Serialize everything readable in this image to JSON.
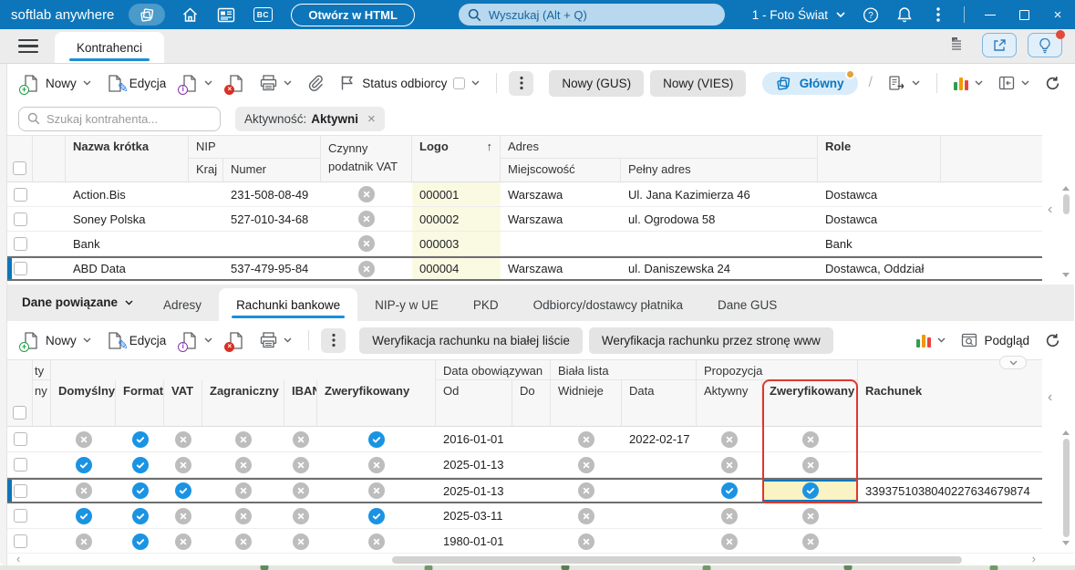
{
  "title_bar": {
    "app_name": "softlab anywhere",
    "bc_label": "BC",
    "open_html_label": "Otwórz w HTML",
    "search_placeholder": "Wyszukaj (Alt + Q)",
    "company": "1 - Foto Świat"
  },
  "tab_bar": {
    "active_tab": "Kontrahenci"
  },
  "toolbar_upper": {
    "new_label": "Nowy",
    "edit_label": "Edycja",
    "status_label": "Status odbiorcy",
    "new_gus_label": "Nowy (GUS)",
    "new_vies_label": "Nowy (VIES)",
    "main_view_label": "Główny",
    "slash": "/"
  },
  "filters": {
    "search_placeholder": "Szukaj kontrahenta...",
    "activity_label": "Aktywność:",
    "activity_value": "Aktywni"
  },
  "upper_grid": {
    "headers": {
      "nazwa": "Nazwa krótka",
      "nip": "NIP",
      "kraj": "Kraj",
      "numer": "Numer",
      "czynny": "Czynny podatnik VAT",
      "logo": "Logo",
      "adres": "Adres",
      "miejscowosc": "Miejscowość",
      "pelny_adres": "Pełny adres",
      "role": "Role"
    },
    "sort_icon": "↑",
    "rows": [
      {
        "name": "Action.Bis",
        "nip": "231-508-08-49",
        "vat_active": "cross",
        "logo": "000001",
        "city": "Warszawa",
        "address": "Ul. Jana Kazimierza 46",
        "role": "Dostawca",
        "selected": false
      },
      {
        "name": "Soney Polska",
        "nip": "527-010-34-68",
        "vat_active": "cross",
        "logo": "000002",
        "city": "Warszawa",
        "address": "ul. Ogrodowa 58",
        "role": "Dostawca",
        "selected": false
      },
      {
        "name": "Bank",
        "nip": "",
        "vat_active": "cross",
        "logo": "000003",
        "city": "",
        "address": "",
        "role": "Bank",
        "selected": false
      },
      {
        "name": "ABD Data",
        "nip": "537-479-95-84",
        "vat_active": "cross",
        "logo": "000004",
        "city": "Warszawa",
        "address": "ul. Daniszewska 24",
        "role": "Dostawca, Oddział",
        "selected": true
      }
    ]
  },
  "detail_tabs": {
    "menu_label": "Dane powiązane",
    "tabs": [
      "Adresy",
      "Rachunki bankowe",
      "NIP-y w UE",
      "PKD",
      "Odbiorcy/dostawcy płatnika",
      "Dane GUS"
    ],
    "active_tab": "Rachunki bankowe"
  },
  "toolbar_lower": {
    "new_label": "Nowy",
    "edit_label": "Edycja",
    "verify_whitelist_label": "Weryfikacja rachunku na białej liście",
    "verify_www_label": "Weryfikacja rachunku przez stronę www",
    "preview_label": "Podgląd"
  },
  "lower_grid": {
    "group_headers": {
      "truncated": "ty",
      "validity": "Data obowiązywan",
      "whitelist": "Biała lista",
      "proposal": "Propozycja"
    },
    "headers": {
      "truncated": "ny",
      "domyslny": "Domyślny",
      "format": "Format",
      "vat": "VAT",
      "zagraniczny": "Zagraniczny",
      "iban": "IBAN",
      "zweryfikowany": "Zweryfikowany",
      "od": "Od",
      "do": "Do",
      "widnieje": "Widnieje",
      "data": "Data",
      "aktywny": "Aktywny",
      "prop_zweryfikowany": "Zweryfikowany",
      "rachunek": "Rachunek"
    },
    "rows": [
      {
        "domyslny": "cross",
        "format": "check",
        "vat": "cross",
        "zagraniczny": "cross",
        "iban": "cross",
        "zweryfikowany": "check",
        "od": "2016-01-01",
        "do": "",
        "widnieje": "cross",
        "data": "2022-02-17",
        "aktywny": "cross",
        "prop_zweryfikowany": "cross",
        "rachunek": "",
        "selected": false
      },
      {
        "domyslny": "check",
        "format": "check",
        "vat": "cross",
        "zagraniczny": "cross",
        "iban": "cross",
        "zweryfikowany": "cross",
        "od": "2025-01-13",
        "do": "",
        "widnieje": "cross",
        "data": "",
        "aktywny": "cross",
        "prop_zweryfikowany": "cross",
        "rachunek": "",
        "selected": false
      },
      {
        "domyslny": "cross",
        "format": "check",
        "vat": "check",
        "zagraniczny": "cross",
        "iban": "cross",
        "zweryfikowany": "cross",
        "od": "2025-01-13",
        "do": "",
        "widnieje": "cross",
        "data": "",
        "aktywny": "check",
        "prop_zweryfikowany": "check",
        "rachunek": "3393751038040227634679874",
        "selected": true
      },
      {
        "domyslny": "check",
        "format": "check",
        "vat": "cross",
        "zagraniczny": "cross",
        "iban": "cross",
        "zweryfikowany": "check",
        "od": "2025-03-11",
        "do": "",
        "widnieje": "cross",
        "data": "",
        "aktywny": "cross",
        "prop_zweryfikowany": "cross",
        "rachunek": "",
        "selected": false
      },
      {
        "domyslny": "cross",
        "format": "check",
        "vat": "cross",
        "zagraniczny": "cross",
        "iban": "cross",
        "zweryfikowany": "cross",
        "od": "1980-01-01",
        "do": "",
        "widnieje": "cross",
        "data": "",
        "aktywny": "cross",
        "prop_zweryfikowany": "cross",
        "rachunek": "",
        "selected": false
      }
    ]
  },
  "icons": {
    "new": "document-plus",
    "edit": "document-pencil",
    "info": "document-info",
    "delete": "document-delete",
    "print": "printer",
    "attachment": "paperclip",
    "status_flag": "flag",
    "chart": "bar-chart",
    "refresh": "refresh",
    "export": "document-export",
    "dock": "dock-left-panel",
    "preview": "preview-window",
    "search": "magnifier",
    "more": "kebab-menu",
    "check": "check-circle",
    "cross": "cross-circle"
  },
  "colors": {
    "titlebar": "#0d76ba",
    "accent_blue": "#1b8fd6",
    "check_circle": "#1b93e3",
    "cross_circle": "#bdbdbd",
    "highlight_red": "#df372c",
    "selected_cell_bg": "#fbf3c4",
    "logo_column_bg": "#fafae3",
    "notification_dot": "#e2a23b"
  }
}
